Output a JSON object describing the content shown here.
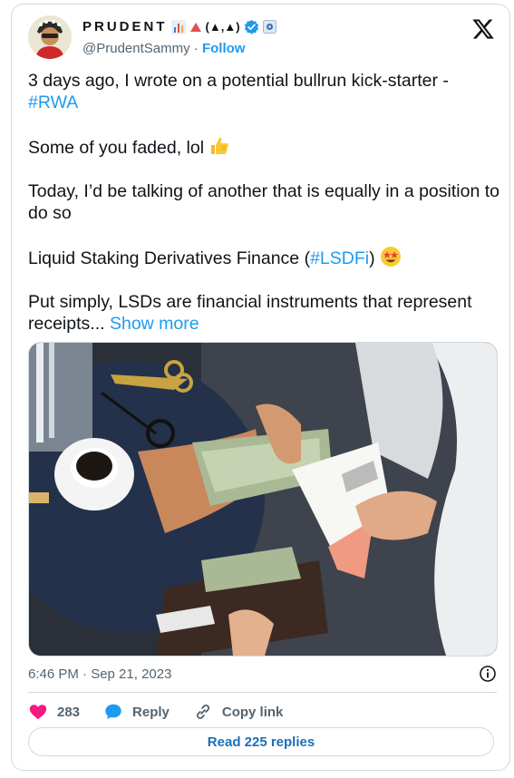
{
  "user": {
    "display_name": "PRUDENT",
    "name_suffix": "(▲,▲)",
    "handle": "@PrudentSammy",
    "separator": "·",
    "follow_label": "Follow",
    "verified_color": "#1d9bf0"
  },
  "tweet": {
    "line1": "3 days ago, I wrote on a potential bullrun kick-starter -",
    "hashtag_rwa": "#RWA",
    "line2": "Some of you faded, lol",
    "line3": "Today, I’d be talking of another that is equally in a position to do so",
    "line4_pre": "Liquid Staking Derivatives Finance (",
    "hashtag_lsdfi": "#LSDFi",
    "line4_post": ")",
    "line5": "Put simply, LSDs are financial instruments that represent receipts...",
    "show_more": "Show more"
  },
  "meta": {
    "timestamp": "6:46 PM · Sep 21, 2023"
  },
  "actions": {
    "likes": "283",
    "reply_label": "Reply",
    "copy_link_label": "Copy link"
  },
  "read_replies_label": "Read 225 replies",
  "icons": {
    "x_logo": "x-logo-icon",
    "heart": "heart-icon",
    "reply": "speech-bubble-icon",
    "link": "link-icon",
    "info": "info-icon"
  },
  "colors": {
    "accent": "#1d9bf0",
    "heart": "#f91880",
    "muted": "#536471"
  }
}
